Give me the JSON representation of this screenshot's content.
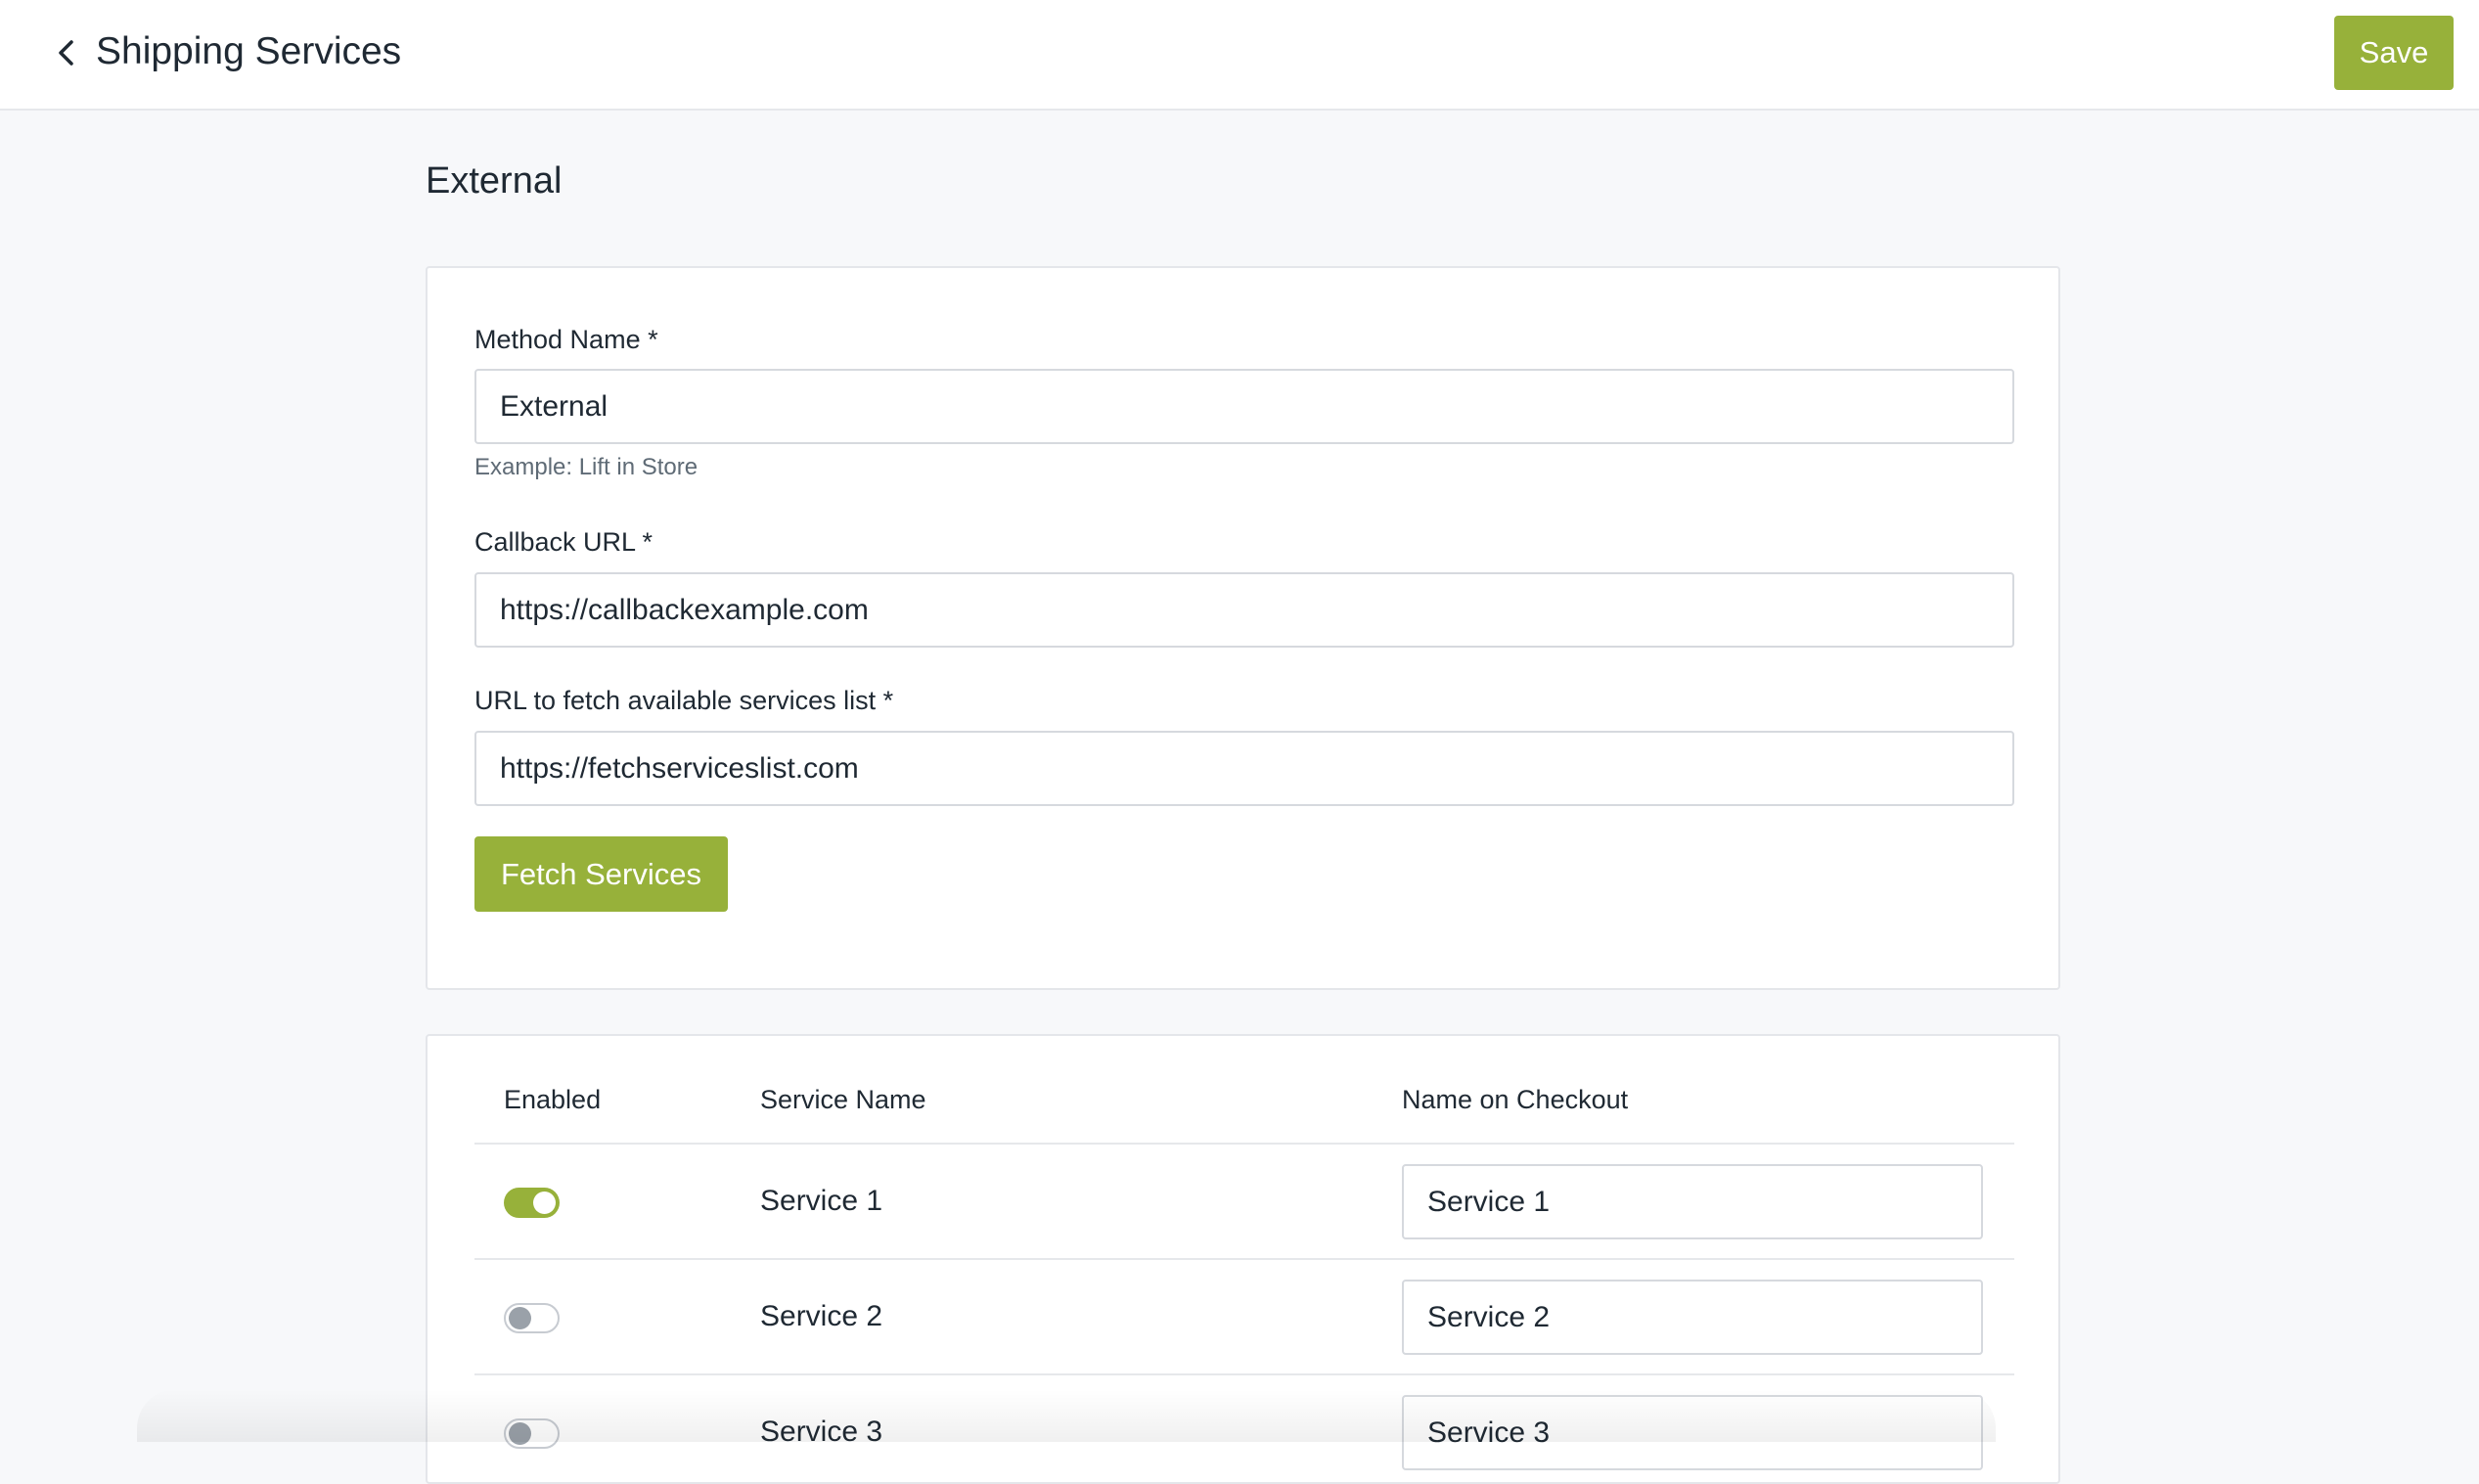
{
  "header": {
    "title": "Shipping Services",
    "save_label": "Save"
  },
  "section": {
    "heading": "External"
  },
  "form": {
    "method_name": {
      "label": "Method Name *",
      "value": "External",
      "hint": "Example: Lift in Store"
    },
    "callback_url": {
      "label": "Callback URL *",
      "value": "https://callbackexample.com"
    },
    "fetch_url": {
      "label": "URL to fetch available services list *",
      "value": "https://fetchserviceslist.com"
    },
    "fetch_button_label": "Fetch Services"
  },
  "services_table": {
    "headers": {
      "enabled": "Enabled",
      "service_name": "Service Name",
      "name_on_checkout": "Name on Checkout"
    },
    "rows": [
      {
        "enabled": true,
        "service_name": "Service 1",
        "name_on_checkout": "Service 1"
      },
      {
        "enabled": false,
        "service_name": "Service 2",
        "name_on_checkout": "Service 2"
      },
      {
        "enabled": false,
        "service_name": "Service 3",
        "name_on_checkout": "Service 3"
      }
    ]
  },
  "icons": {
    "back": "chevron-left-icon"
  },
  "colors": {
    "accent": "#97b13a",
    "background": "#f7f8fa",
    "card": "#ffffff",
    "border": "#d6d9de",
    "text": "#1f2933",
    "muted_text": "#5f6b76"
  }
}
